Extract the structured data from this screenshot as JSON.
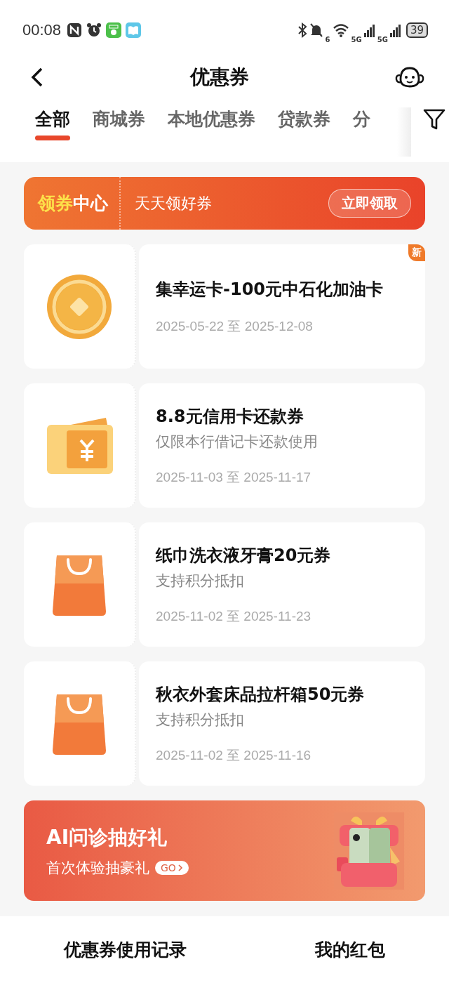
{
  "status_bar": {
    "time": "00:08",
    "battery": "39",
    "network_1": "5G",
    "network_2": "5G",
    "wifi_gen": "6"
  },
  "header": {
    "title": "优惠券"
  },
  "tabs": [
    {
      "label": "全部",
      "selected": true
    },
    {
      "label": "商城券",
      "selected": false
    },
    {
      "label": "本地优惠券",
      "selected": false
    },
    {
      "label": "贷款券",
      "selected": false
    },
    {
      "label": "分",
      "selected": false
    }
  ],
  "banner": {
    "logo_part_1": "领券",
    "logo_part_2": "中心",
    "slogan": "天天领好券",
    "button": "立即领取"
  },
  "coupons": [
    {
      "kind": "coin",
      "title": "集幸运卡-100元中石化加油卡",
      "validity": "2025-05-22 至 2025-12-08",
      "new": true,
      "new_label": "新"
    },
    {
      "kind": "ticket",
      "title": "8.8元信用卡还款券",
      "subtitle": "仅限本行借记卡还款使用",
      "validity": "2025-11-03 至 2025-11-17",
      "new": false
    },
    {
      "kind": "bag",
      "title": "纸巾洗衣液牙膏20元券",
      "subtitle": "支持积分抵扣",
      "validity": "2025-11-02 至 2025-11-23",
      "new": false
    },
    {
      "kind": "bag",
      "title": "秋衣外套床品拉杆箱50元券",
      "subtitle": "支持积分抵扣",
      "validity": "2025-11-02 至 2025-11-16",
      "new": false
    }
  ],
  "promo": {
    "title": "AI问诊抽好礼",
    "subtitle": "首次体验抽豪礼",
    "go": "GO"
  },
  "bottom_bar": [
    "优惠券使用记录",
    "我的红包"
  ]
}
